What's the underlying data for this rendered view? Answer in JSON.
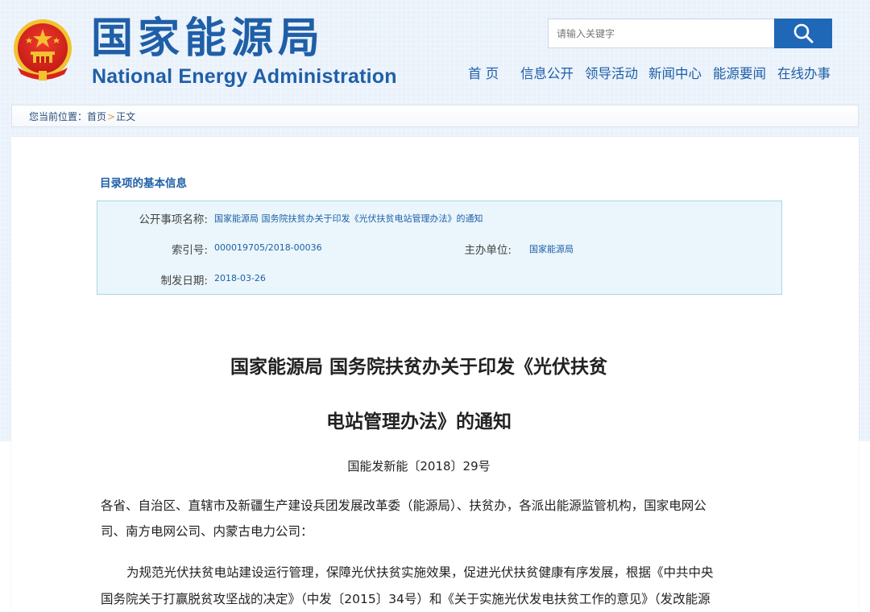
{
  "header": {
    "logo_cn": "国家能源局",
    "logo_en": "National Energy Administration",
    "search": {
      "placeholder": "请输入关键字"
    },
    "nav": [
      "首 页",
      "信息公开",
      "领导活动",
      "新闻中心",
      "能源要闻",
      "在线办事"
    ]
  },
  "breadcrumb": {
    "prefix": "您当前位置：",
    "items": [
      "首页",
      "正文"
    ],
    "separator": ">"
  },
  "info": {
    "title": "目录项的基本信息",
    "name_label": "公开事项名称:",
    "name_value": "国家能源局 国务院扶贫办关于印发《光伏扶贫电站管理办法》的通知",
    "index_label": "索引号:",
    "index_value": "000019705/2018-00036",
    "org_label": "主办单位:",
    "org_value": "国家能源局",
    "date_label": "制发日期:",
    "date_value": "2018-03-26"
  },
  "document": {
    "title_line1": "国家能源局 国务院扶贫办关于印发《光伏扶贫",
    "title_line2": "电站管理办法》的通知",
    "doc_number": "国能发新能〔2018〕29号",
    "para1_line1": "各省、自治区、直辖市及新疆生产建设兵团发展改革委（能源局）、扶贫办，各派出能源监管机构，国家电网公",
    "para1_line2": "司、南方电网公司、内蒙古电力公司：",
    "para2_line1": "为规范光伏扶贫电站建设运行管理，保障光伏扶贫实施效果，促进光伏扶贫健康有序发展，根据《中共中央",
    "para2_line2": "国务院关于打赢脱贫攻坚战的决定》（中发〔2015〕34号）和《关于实施光伏发电扶贫工作的意见》（发改能源"
  },
  "colors": {
    "brand_blue": "#1f5fa8",
    "search_button": "#1f68b8",
    "emblem_red": "#d8231c",
    "emblem_gold": "#f2c230"
  }
}
